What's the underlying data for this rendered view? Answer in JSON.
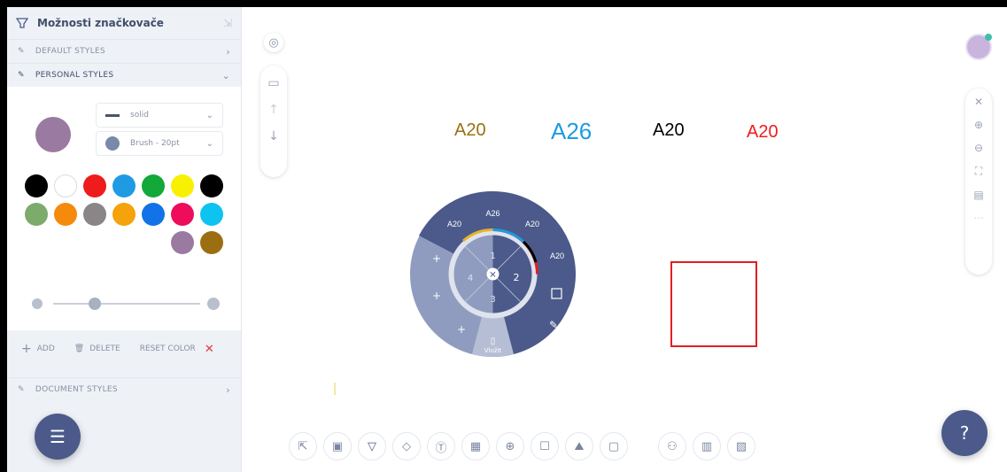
{
  "panel": {
    "title": "Možnosti značkovače",
    "sections": {
      "default": "DEFAULT STYLES",
      "personal": "PERSONAL STYLES",
      "document": "DOCUMENT STYLES"
    },
    "line_style": "solid",
    "brush": "Brush - 20pt",
    "selected_color": "#9a7aa0",
    "palette": [
      "#000000",
      "#ffffff",
      "#ee1c1c",
      "#1e9be3",
      "#12a83a",
      "#f7f000",
      "#000000",
      "#7cab6c",
      "#f58a0b",
      "#8a8586",
      "#f5a20b",
      "#1273e8",
      "#ee0d5a",
      "#0fc3f0",
      "#9a7aa0",
      "#9c6e12"
    ],
    "actions": {
      "add": "ADD",
      "delete": "DELETE",
      "reset": "RESET COLOR"
    }
  },
  "canvas": {
    "texts": [
      {
        "text": "A20",
        "color": "#9c6e12"
      },
      {
        "text": "A26",
        "color": "#1e9be3"
      },
      {
        "text": "A20",
        "color": "#000000"
      },
      {
        "text": "A20",
        "color": "#ee1c1c"
      }
    ]
  },
  "radial": {
    "labels": [
      "A20",
      "A26",
      "A20",
      "A20"
    ],
    "inner": [
      "1",
      "2",
      "3",
      "4"
    ],
    "bottom_label": "Vložit"
  },
  "icons": {
    "panel": "marker-icon",
    "menu": "menu-icon",
    "help": "help-chat-icon"
  }
}
